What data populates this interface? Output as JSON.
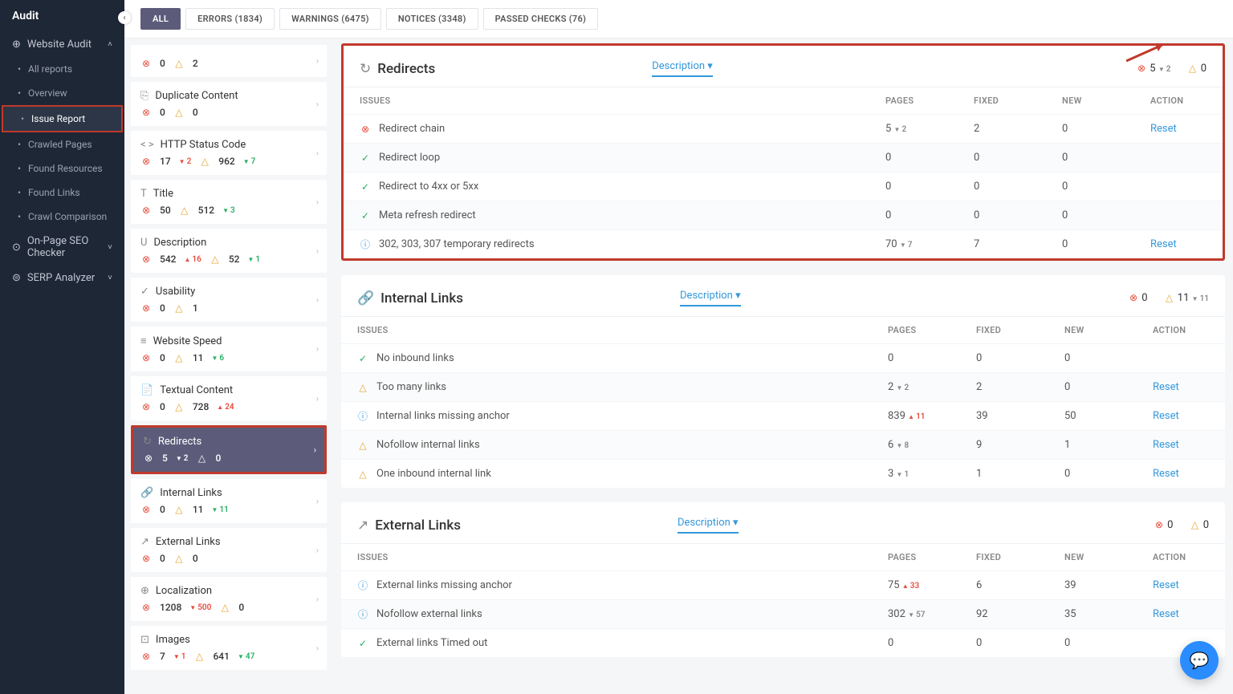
{
  "sidebar": {
    "title": "Audit",
    "sections": [
      {
        "label": "Website Audit",
        "icon": "⊕",
        "expanded": true,
        "items": [
          {
            "label": "All reports"
          },
          {
            "label": "Overview"
          },
          {
            "label": "Issue Report",
            "active": true,
            "highlight": true
          },
          {
            "label": "Crawled Pages"
          },
          {
            "label": "Found Resources"
          },
          {
            "label": "Found Links"
          },
          {
            "label": "Crawl Comparison"
          }
        ]
      },
      {
        "label": "On-Page SEO Checker",
        "icon": "⊙",
        "expanded": false,
        "items": []
      },
      {
        "label": "SERP Analyzer",
        "icon": "⊜",
        "expanded": false,
        "items": []
      }
    ]
  },
  "tabs": [
    {
      "label": "ALL",
      "active": true
    },
    {
      "label": "ERRORS (1834)"
    },
    {
      "label": "WARNINGS (6475)"
    },
    {
      "label": "NOTICES (3348)"
    },
    {
      "label": "PASSED CHECKS (76)"
    }
  ],
  "issueList": [
    {
      "icon": "",
      "title": "",
      "err": "0",
      "warn": "2",
      "chev": true,
      "partial": true
    },
    {
      "icon": "⎘",
      "title": "Duplicate Content",
      "err": "0",
      "warn": "0"
    },
    {
      "icon": "< >",
      "title": "HTTP Status Code",
      "err": "17",
      "errDelta": "2",
      "errDir": "down",
      "warn": "962",
      "warnDelta": "7",
      "warnDir": "down"
    },
    {
      "icon": "T",
      "title": "Title",
      "err": "50",
      "warn": "512",
      "warnDelta": "3",
      "warnDir": "down"
    },
    {
      "icon": "U",
      "title": "Description",
      "err": "542",
      "errDelta": "16",
      "errDir": "up",
      "warn": "52",
      "warnDelta": "1",
      "warnDir": "down"
    },
    {
      "icon": "✓",
      "title": "Usability",
      "err": "0",
      "warn": "1"
    },
    {
      "icon": "≡",
      "title": "Website Speed",
      "err": "0",
      "warn": "11",
      "warnDelta": "6",
      "warnDir": "down"
    },
    {
      "icon": "📄",
      "title": "Textual Content",
      "err": "0",
      "warn": "728",
      "warnDelta": "24",
      "warnDir": "up"
    },
    {
      "icon": "↻",
      "title": "Redirects",
      "err": "5",
      "errDelta": "2",
      "errDir": "down",
      "warn": "0",
      "selected": true,
      "highlight": true
    },
    {
      "icon": "🔗",
      "title": "Internal Links",
      "err": "0",
      "warn": "11",
      "warnDelta": "11",
      "warnDir": "down"
    },
    {
      "icon": "↗",
      "title": "External Links",
      "err": "0",
      "warn": "0"
    },
    {
      "icon": "⊕",
      "title": "Localization",
      "err": "1208",
      "errDelta": "500",
      "errDir": "down",
      "warn": "0"
    },
    {
      "icon": "⊡",
      "title": "Images",
      "err": "7",
      "errDelta": "1",
      "errDir": "down",
      "warn": "641",
      "warnDelta": "47",
      "warnDir": "down"
    }
  ],
  "panels": [
    {
      "title": "Redirects",
      "icon": "↻",
      "highlight": true,
      "descLabel": "Description",
      "statErr": "5",
      "statErrDelta": "2",
      "statErrDir": "down",
      "statWarn": "0",
      "columns": [
        "ISSUES",
        "PAGES",
        "FIXED",
        "NEW",
        "ACTION"
      ],
      "rows": [
        {
          "icon": "⊗",
          "cls": "red",
          "name": "Redirect chain",
          "pages": "5",
          "pagesDelta": "2",
          "pagesDir": "down",
          "fixed": "2",
          "new": "0",
          "action": "Reset",
          "arrow": true
        },
        {
          "icon": "✓",
          "cls": "green",
          "name": "Redirect loop",
          "pages": "0",
          "fixed": "0",
          "new": "0"
        },
        {
          "icon": "✓",
          "cls": "green",
          "name": "Redirect to 4xx or 5xx",
          "pages": "0",
          "fixed": "0",
          "new": "0"
        },
        {
          "icon": "✓",
          "cls": "green",
          "name": "Meta refresh redirect",
          "pages": "0",
          "fixed": "0",
          "new": "0"
        },
        {
          "icon": "ⓘ",
          "cls": "blue",
          "name": "302, 303, 307 temporary redirects",
          "pages": "70",
          "pagesDelta": "7",
          "pagesDir": "down",
          "fixed": "7",
          "new": "0",
          "action": "Reset"
        }
      ]
    },
    {
      "title": "Internal Links",
      "icon": "🔗",
      "descLabel": "Description",
      "statErr": "0",
      "statWarn": "11",
      "statWarnDelta": "11",
      "statWarnDir": "down",
      "columns": [
        "ISSUES",
        "PAGES",
        "FIXED",
        "NEW",
        "ACTION"
      ],
      "rows": [
        {
          "icon": "✓",
          "cls": "green",
          "name": "No inbound links",
          "pages": "0",
          "fixed": "0",
          "new": "0"
        },
        {
          "icon": "△",
          "cls": "yellow",
          "name": "Too many links",
          "pages": "2",
          "pagesDelta": "2",
          "pagesDir": "down",
          "fixed": "2",
          "new": "0",
          "action": "Reset"
        },
        {
          "icon": "ⓘ",
          "cls": "blue",
          "name": "Internal links missing anchor",
          "pages": "839",
          "pagesDelta": "11",
          "pagesDir": "up",
          "fixed": "39",
          "new": "50",
          "action": "Reset"
        },
        {
          "icon": "△",
          "cls": "yellow",
          "name": "Nofollow internal links",
          "pages": "6",
          "pagesDelta": "8",
          "pagesDir": "down",
          "fixed": "9",
          "new": "1",
          "action": "Reset"
        },
        {
          "icon": "△",
          "cls": "yellow",
          "name": "One inbound internal link",
          "pages": "3",
          "pagesDelta": "1",
          "pagesDir": "down",
          "fixed": "1",
          "new": "0",
          "action": "Reset"
        }
      ]
    },
    {
      "title": "External Links",
      "icon": "↗",
      "descLabel": "Description",
      "statErr": "0",
      "statWarn": "0",
      "columns": [
        "ISSUES",
        "PAGES",
        "FIXED",
        "NEW",
        "ACTION"
      ],
      "rows": [
        {
          "icon": "ⓘ",
          "cls": "blue",
          "name": "External links missing anchor",
          "pages": "75",
          "pagesDelta": "33",
          "pagesDir": "up",
          "fixed": "6",
          "new": "39",
          "action": "Reset"
        },
        {
          "icon": "ⓘ",
          "cls": "blue",
          "name": "Nofollow external links",
          "pages": "302",
          "pagesDelta": "57",
          "pagesDir": "down",
          "fixed": "92",
          "new": "35",
          "action": "Reset"
        },
        {
          "icon": "✓",
          "cls": "green",
          "name": "External links Timed out",
          "pages": "0",
          "fixed": "0",
          "new": "0"
        }
      ]
    }
  ],
  "chev": "▾"
}
